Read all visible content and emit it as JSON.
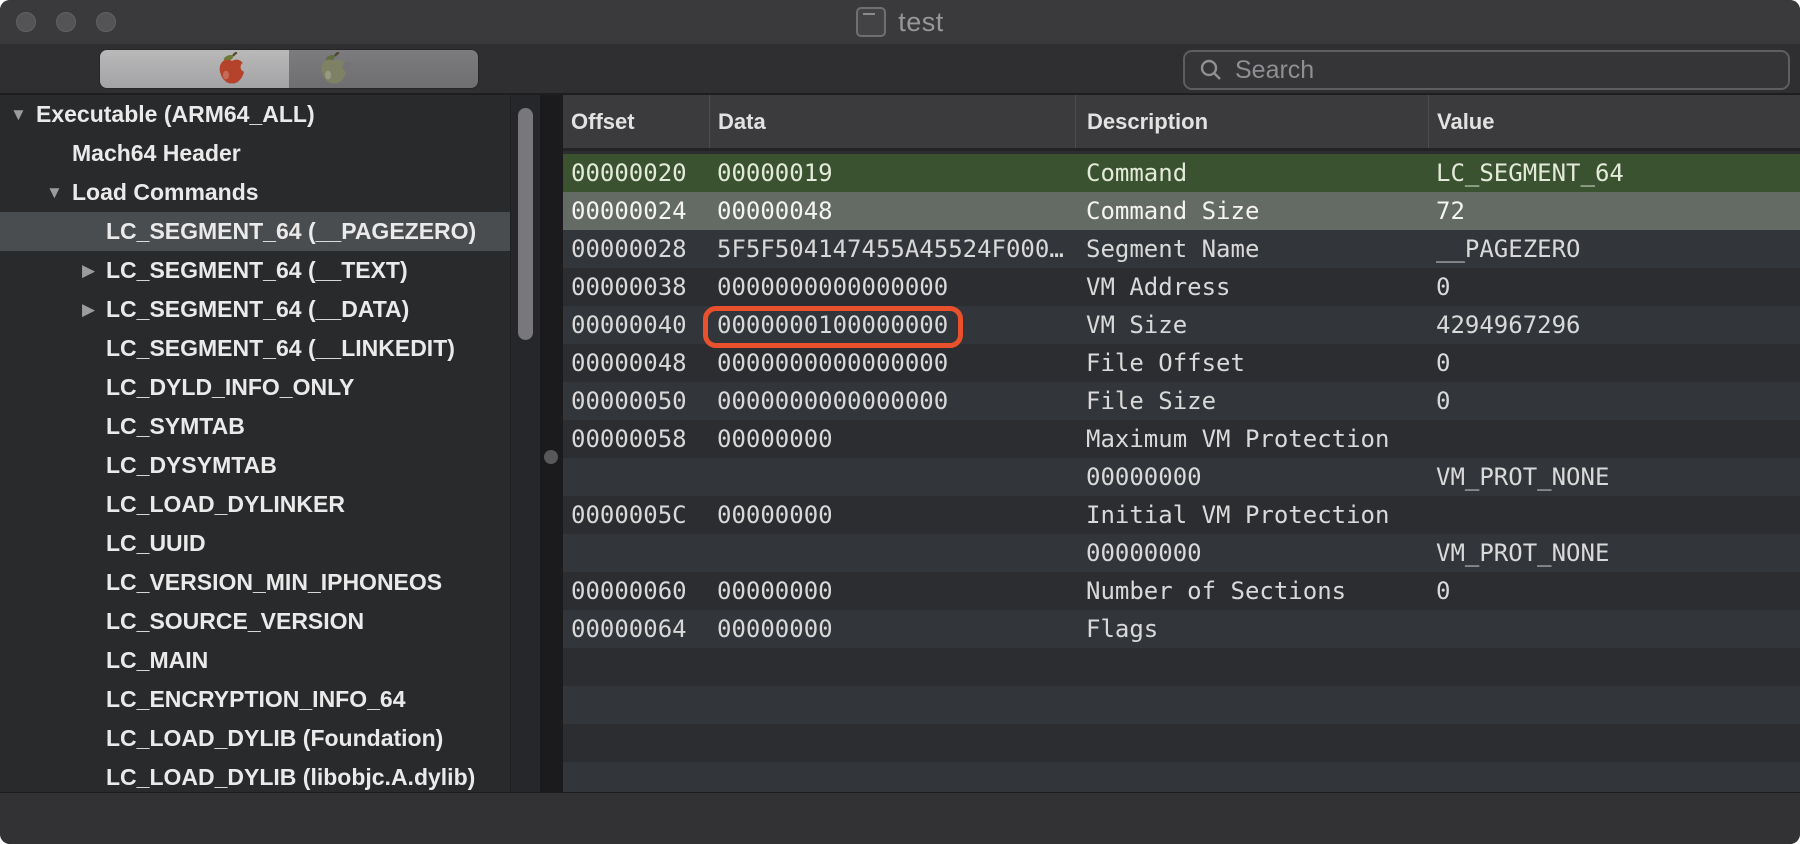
{
  "window": {
    "title": "test"
  },
  "toolbar": {
    "search_placeholder": "Search",
    "segments": [
      {
        "icon": "red-apple-icon",
        "selected": true
      },
      {
        "icon": "olive-apple-icon",
        "selected": false
      }
    ]
  },
  "sidebar": {
    "items": [
      {
        "label": "Executable (ARM64_ALL)",
        "depth": 0,
        "arrow": "expanded",
        "selected": false
      },
      {
        "label": "Mach64 Header",
        "depth": 1,
        "arrow": "none",
        "selected": false
      },
      {
        "label": "Load Commands",
        "depth": 1,
        "arrow": "expanded",
        "selected": false
      },
      {
        "label": "LC_SEGMENT_64 (__PAGEZERO)",
        "depth": 2,
        "arrow": "none",
        "selected": true
      },
      {
        "label": "LC_SEGMENT_64 (__TEXT)",
        "depth": 2,
        "arrow": "collapsed",
        "selected": false
      },
      {
        "label": "LC_SEGMENT_64 (__DATA)",
        "depth": 2,
        "arrow": "collapsed",
        "selected": false
      },
      {
        "label": "LC_SEGMENT_64 (__LINKEDIT)",
        "depth": 2,
        "arrow": "none",
        "selected": false
      },
      {
        "label": "LC_DYLD_INFO_ONLY",
        "depth": 2,
        "arrow": "none",
        "selected": false
      },
      {
        "label": "LC_SYMTAB",
        "depth": 2,
        "arrow": "none",
        "selected": false
      },
      {
        "label": "LC_DYSYMTAB",
        "depth": 2,
        "arrow": "none",
        "selected": false
      },
      {
        "label": "LC_LOAD_DYLINKER",
        "depth": 2,
        "arrow": "none",
        "selected": false
      },
      {
        "label": "LC_UUID",
        "depth": 2,
        "arrow": "none",
        "selected": false
      },
      {
        "label": "LC_VERSION_MIN_IPHONEOS",
        "depth": 2,
        "arrow": "none",
        "selected": false
      },
      {
        "label": "LC_SOURCE_VERSION",
        "depth": 2,
        "arrow": "none",
        "selected": false
      },
      {
        "label": "LC_MAIN",
        "depth": 2,
        "arrow": "none",
        "selected": false
      },
      {
        "label": "LC_ENCRYPTION_INFO_64",
        "depth": 2,
        "arrow": "none",
        "selected": false
      },
      {
        "label": "LC_LOAD_DYLIB (Foundation)",
        "depth": 2,
        "arrow": "none",
        "selected": false
      },
      {
        "label": "LC_LOAD_DYLIB (libobjc.A.dylib)",
        "depth": 2,
        "arrow": "none",
        "selected": false
      }
    ]
  },
  "table": {
    "columns": [
      "Offset",
      "Data",
      "Description",
      "Value"
    ],
    "rows": [
      {
        "offset": "00000020",
        "data": "00000019",
        "description": "Command",
        "value": "LC_SEGMENT_64",
        "highlight": "green"
      },
      {
        "offset": "00000024",
        "data": "00000048",
        "description": "Command Size",
        "value": "72",
        "highlight": "gray"
      },
      {
        "offset": "00000028",
        "data": "5F5F504147455A45524F000…",
        "description": "Segment Name",
        "value": "__PAGEZERO",
        "highlight": null
      },
      {
        "offset": "00000038",
        "data": "0000000000000000",
        "description": "VM Address",
        "value": "0",
        "highlight": null
      },
      {
        "offset": "00000040",
        "data": "0000000100000000",
        "description": "VM Size",
        "value": "4294967296",
        "highlight": null
      },
      {
        "offset": "00000048",
        "data": "0000000000000000",
        "description": "File Offset",
        "value": "0",
        "highlight": null
      },
      {
        "offset": "00000050",
        "data": "0000000000000000",
        "description": "File Size",
        "value": "0",
        "highlight": null
      },
      {
        "offset": "00000058",
        "data": "00000000",
        "description": "Maximum VM Protection",
        "value": "",
        "highlight": null
      },
      {
        "offset": "",
        "data": "",
        "description": "00000000",
        "value": "VM_PROT_NONE",
        "highlight": null
      },
      {
        "offset": "0000005C",
        "data": "00000000",
        "description": "Initial VM Protection",
        "value": "",
        "highlight": null
      },
      {
        "offset": "",
        "data": "",
        "description": "00000000",
        "value": "VM_PROT_NONE",
        "highlight": null
      },
      {
        "offset": "00000060",
        "data": "00000000",
        "description": "Number of Sections",
        "value": "0",
        "highlight": null
      },
      {
        "offset": "00000064",
        "data": "00000000",
        "description": "Flags",
        "value": "",
        "highlight": null
      }
    ]
  },
  "annotation": {
    "row_index": 4,
    "column": "data",
    "color": "#e8512c"
  },
  "colors": {
    "selected_row_green": "#3a5230",
    "selected_row_gray": "#646a64",
    "sidebar_selection": "#4a4d50",
    "annotation_orange": "#e8512c"
  }
}
